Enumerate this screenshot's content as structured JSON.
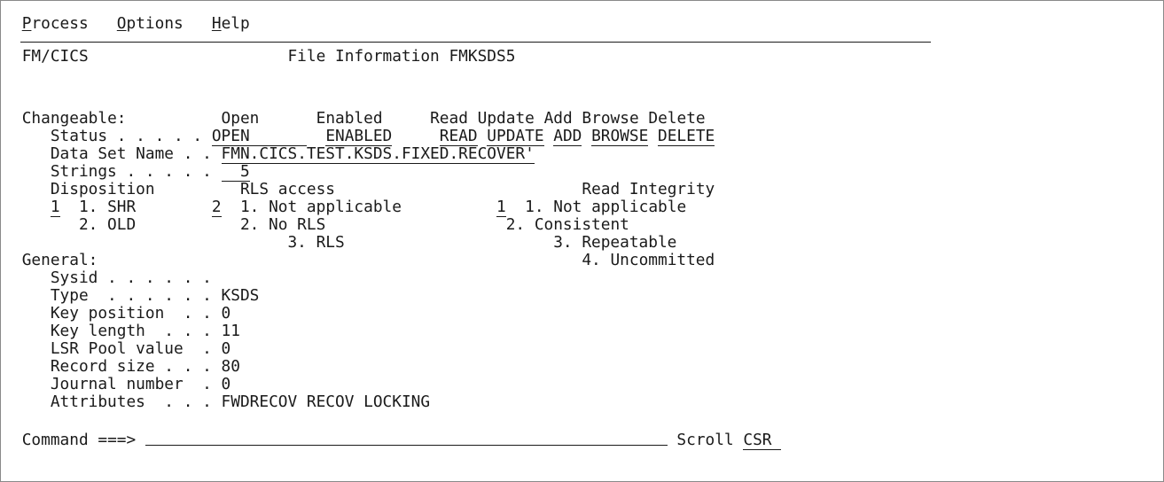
{
  "menu": {
    "process": {
      "mnemonic": "P",
      "rest": "rocess"
    },
    "options": {
      "mnemonic": "O",
      "rest": "ptions"
    },
    "help": {
      "mnemonic": "H",
      "rest": "elp"
    }
  },
  "header": {
    "app": "FM/CICS",
    "title": "File Information FMKSDS5"
  },
  "changeable": {
    "label": "Changeable:",
    "col_open": "Open",
    "col_enabled": "Enabled",
    "col_read": "Read",
    "col_update": "Update",
    "col_add": "Add",
    "col_browse": "Browse",
    "col_delete": "Delete",
    "status_label": "Status . . . . .",
    "status_open": "OPEN",
    "status_enabled": "ENABLED",
    "status_read": "READ",
    "status_update": "UPDATE",
    "status_add": "ADD",
    "status_browse": "BROWSE",
    "status_delete": "DELETE",
    "dsn_label": "Data Set Name . .",
    "dsn_value": "FMN.CICS.TEST.KSDS.FIXED.RECOVER'",
    "strings_label": "Strings . . . . .",
    "strings_value": "5"
  },
  "disposition": {
    "label": "Disposition",
    "selected": "1",
    "options": [
      "1. SHR",
      "2. OLD"
    ]
  },
  "rls": {
    "label": "RLS access",
    "selected": "2",
    "options": [
      "1. Not applicable",
      "2. No RLS",
      "3. RLS"
    ]
  },
  "integrity": {
    "label": "Read Integrity",
    "selected": "1",
    "options": [
      "1. Not applicable",
      "2. Consistent",
      "3. Repeatable",
      "4. Uncommitted"
    ]
  },
  "general": {
    "label": "General:",
    "sysid_label": "Sysid . . . . . .",
    "sysid_value": "",
    "type_label": "Type  . . . . . .",
    "type_value": "KSDS",
    "keypos_label": "Key position  . .",
    "keypos_value": "0",
    "keylen_label": "Key length  . . .",
    "keylen_value": "11",
    "lsr_label": "LSR Pool value  .",
    "lsr_value": "0",
    "recsize_label": "Record size . . .",
    "recsize_value": "80",
    "journal_label": "Journal number  .",
    "journal_value": "0",
    "attr_label": "Attributes  . . .",
    "attr_value": "FWDRECOV RECOV LOCKING"
  },
  "command": {
    "label": "Command ===>",
    "value": "",
    "scroll_label": "Scroll",
    "scroll_value": "CSR"
  }
}
